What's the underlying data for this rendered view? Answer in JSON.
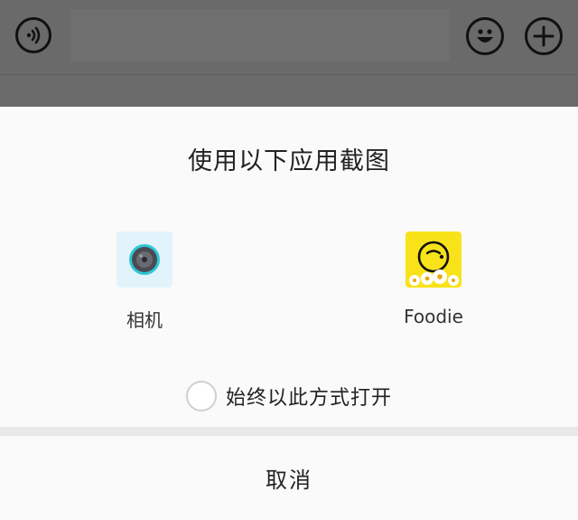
{
  "background": {
    "voice_icon": "voice-icon",
    "emoji_icon": "emoji-icon",
    "plus_icon": "plus-icon"
  },
  "sheet": {
    "title": "使用以下应用截图",
    "apps": [
      {
        "label": "相机",
        "icon": "camera-app-icon"
      },
      {
        "label": "Foodie",
        "icon": "foodie-app-icon"
      }
    ],
    "always_open_label": "始终以此方式打开",
    "always_open_checked": false,
    "cancel_label": "取消"
  },
  "colors": {
    "backdrop": "#6b6b6b",
    "sheet": "#fafafa",
    "foodie_yellow": "#f8e21a",
    "camera_bg": "#e3f3fb",
    "camera_lens_ring": "#2ec6d6"
  }
}
